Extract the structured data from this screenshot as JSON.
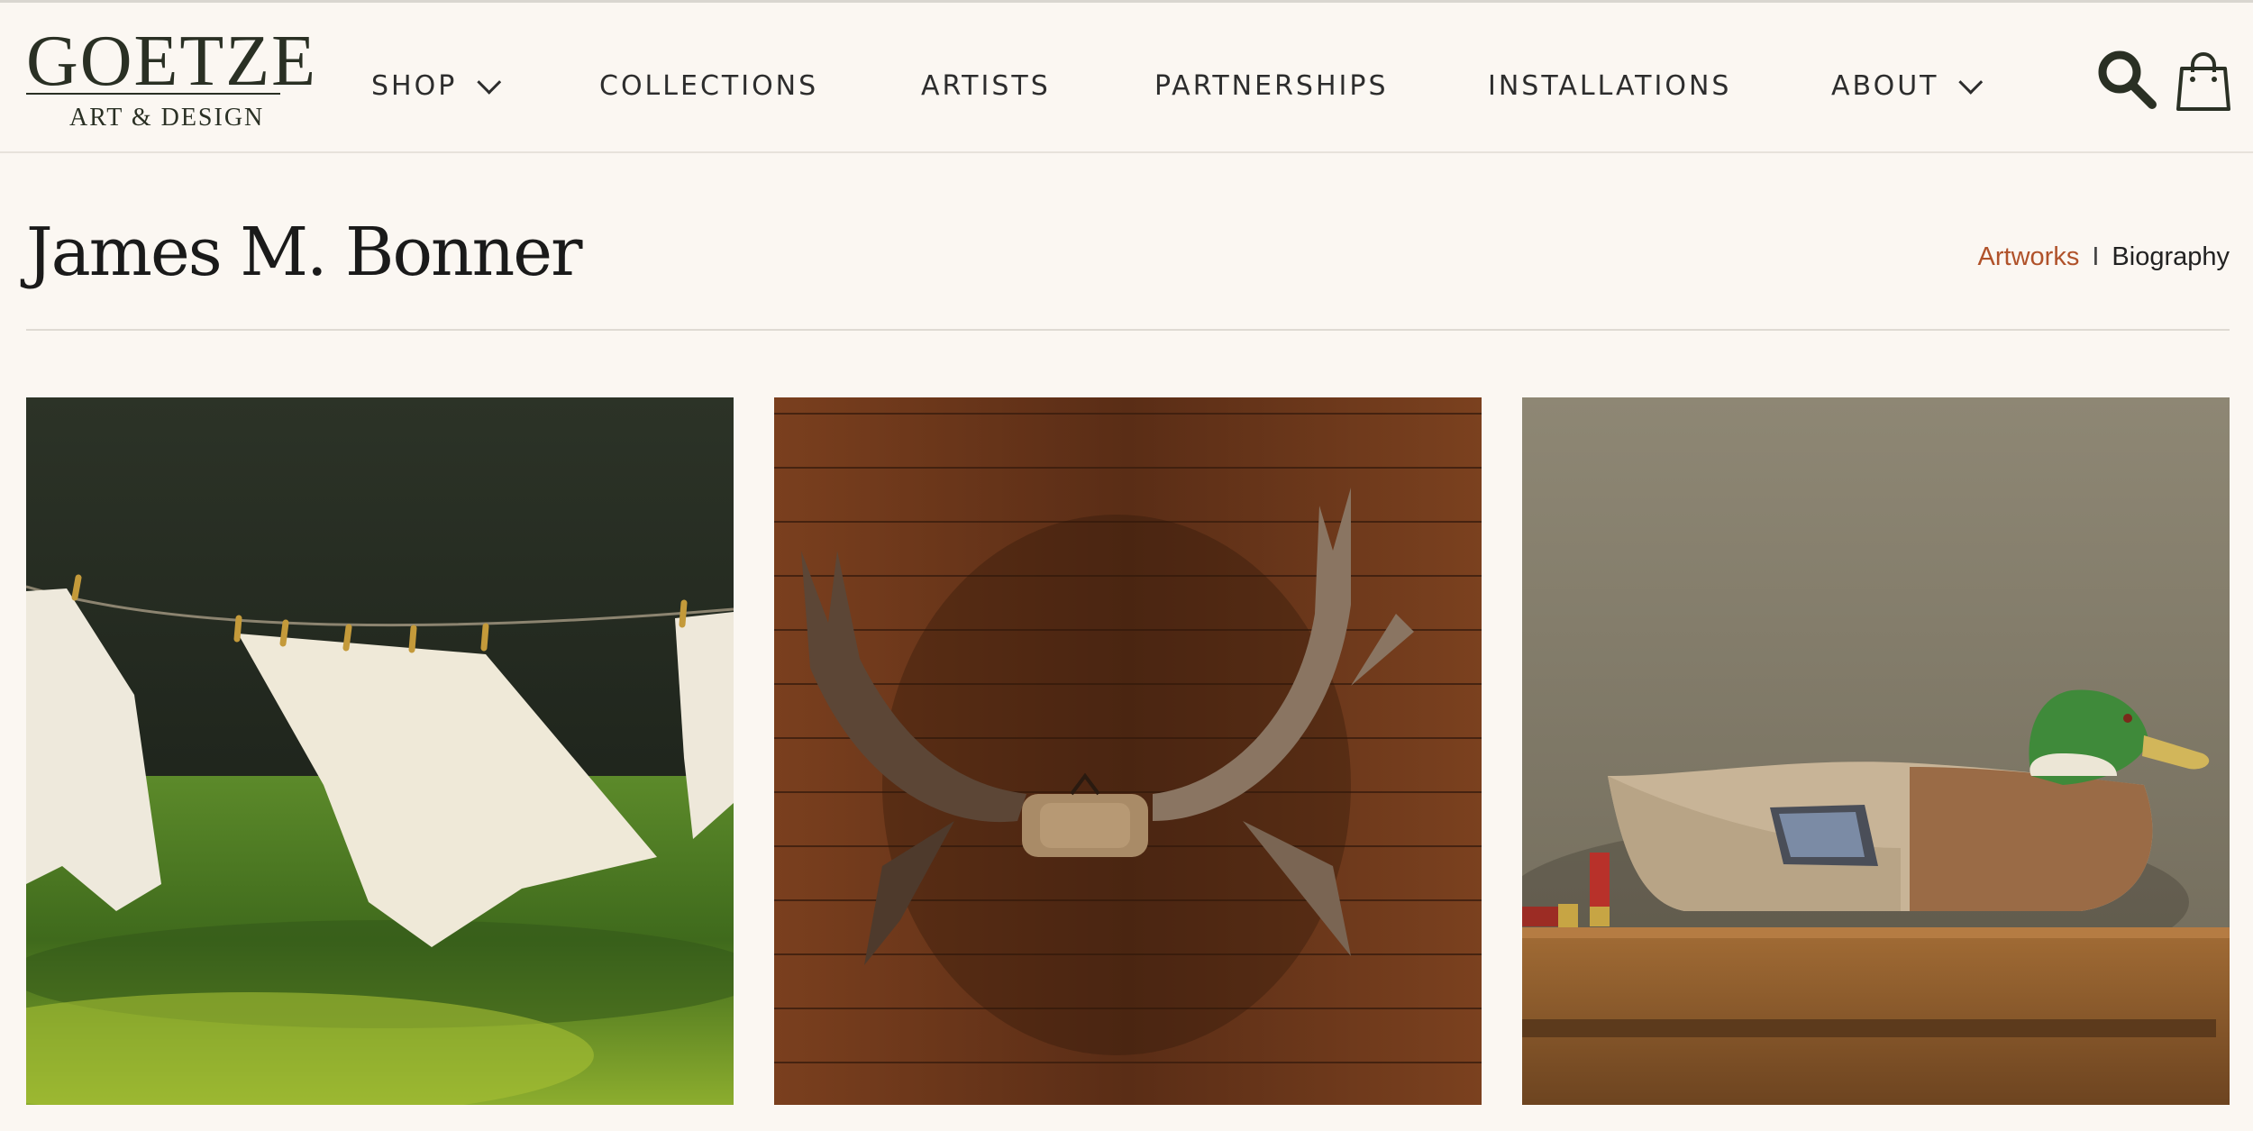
{
  "brand": {
    "name": "GOETZE",
    "tagline": "ART & DESIGN"
  },
  "nav": {
    "items": [
      {
        "label": "SHOP",
        "has_dropdown": true
      },
      {
        "label": "COLLECTIONS",
        "has_dropdown": false
      },
      {
        "label": "ARTISTS",
        "has_dropdown": false
      },
      {
        "label": "PARTNERSHIPS",
        "has_dropdown": false
      },
      {
        "label": "INSTALLATIONS",
        "has_dropdown": false
      },
      {
        "label": "ABOUT",
        "has_dropdown": true
      }
    ],
    "icons": [
      "search-icon",
      "shopping-bag-icon"
    ]
  },
  "page": {
    "title": "James M. Bonner",
    "tabs": [
      {
        "label": "Artworks",
        "active": true
      },
      {
        "label": "Biography",
        "active": false
      }
    ]
  },
  "artworks": [
    {
      "subject": "laundry on clothesline"
    },
    {
      "subject": "moose antlers on wood wall"
    },
    {
      "subject": "mallard duck decoy on shelf"
    }
  ],
  "colors": {
    "background": "#fbf7f2",
    "accent": "#b0522a",
    "logo": "#2a3024"
  }
}
